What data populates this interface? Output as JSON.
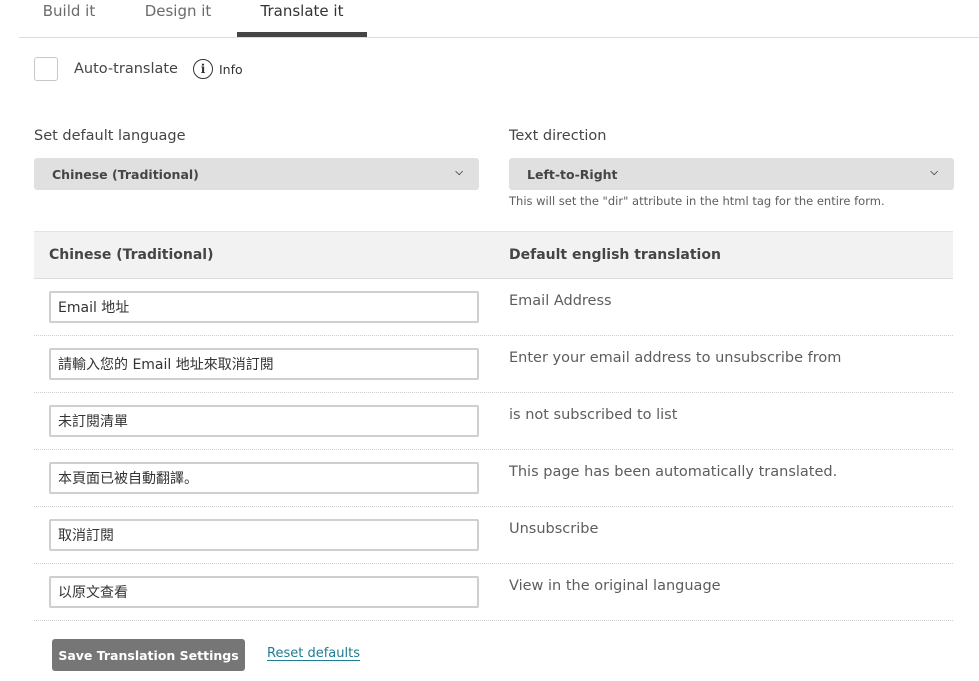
{
  "tabs": [
    {
      "label": "Build it",
      "active": false
    },
    {
      "label": "Design it",
      "active": false
    },
    {
      "label": "Translate it",
      "active": true
    }
  ],
  "auto_translate": {
    "label": "Auto-translate",
    "checked": false,
    "info_label": "Info",
    "info_icon": "info-circle-icon"
  },
  "settings": {
    "language_label": "Set default language",
    "language_value": "Chinese (Traditional)",
    "direction_label": "Text direction",
    "direction_value": "Left-to-Right",
    "direction_help": "This will set the \"dir\" attribute in the html tag for the entire form.",
    "chevron_icon": "chevron-down-icon"
  },
  "table": {
    "headers": [
      "Chinese (Traditional)",
      "Default english translation"
    ],
    "rows": [
      {
        "translation": "Email 地址",
        "english": "Email Address"
      },
      {
        "translation": "請輸入您的 Email 地址來取消訂閱",
        "english": "Enter your email address to unsubscribe from"
      },
      {
        "translation": "未訂閱清單",
        "english": "is not subscribed to list"
      },
      {
        "translation": "本頁面已被自動翻譯。",
        "english": "This page has been automatically translated."
      },
      {
        "translation": "取消訂閱",
        "english": "Unsubscribe"
      },
      {
        "translation": "以原文查看",
        "english": "View in the original language"
      }
    ]
  },
  "footer": {
    "save_label": "Save Translation Settings",
    "reset_label": "Reset defaults"
  },
  "colors": {
    "link": "#1f7b93",
    "button_bg": "#767676",
    "active_tab_bar": "#454545"
  }
}
